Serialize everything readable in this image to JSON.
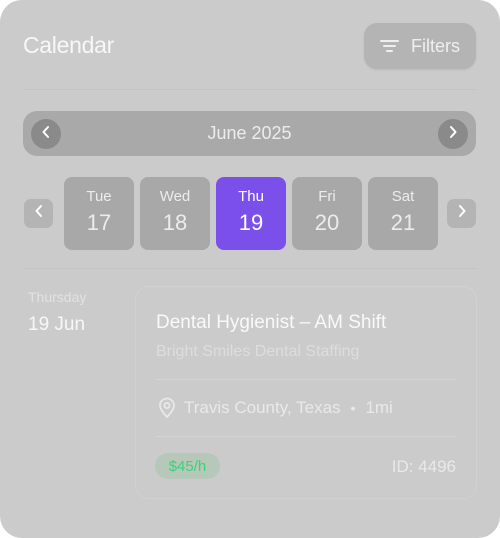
{
  "header": {
    "title": "Calendar",
    "filters_label": "Filters",
    "filters_icon": "filter-lines-icon"
  },
  "month_nav": {
    "label": "June 2025",
    "prev_icon": "chevron-left-icon",
    "next_icon": "chevron-right-icon"
  },
  "week": {
    "days": [
      {
        "name": "Tue",
        "num": "17",
        "selected": false
      },
      {
        "name": "Wed",
        "num": "18",
        "selected": false
      },
      {
        "name": "Thu",
        "num": "19",
        "selected": true
      },
      {
        "name": "Fri",
        "num": "20",
        "selected": false
      },
      {
        "name": "Sat",
        "num": "21",
        "selected": false
      }
    ]
  },
  "selected_date": {
    "weekday": "Thursday",
    "date": "19 Jun"
  },
  "job": {
    "title": "Dental Hygienist – AM Shift",
    "company": "Bright Smiles Dental Staffing",
    "location": "Travis County, Texas",
    "separator": "•",
    "distance": "1mi",
    "pay": "$45/h",
    "id_label": "ID: 4496",
    "location_icon": "map-pin-icon"
  },
  "colors": {
    "panel": "#cbcbcb",
    "accent": "#7b4fe9",
    "pay_text": "#3ed07a"
  }
}
